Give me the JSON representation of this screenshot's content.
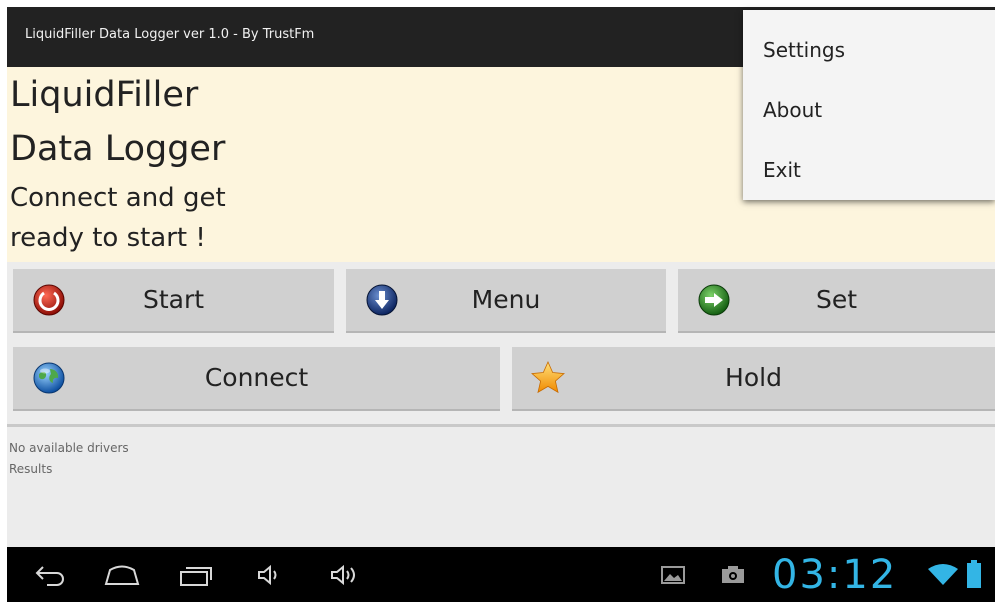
{
  "app": {
    "title": "LiquidFiller Data Logger ver 1.0 - By TrustFm"
  },
  "header": {
    "line1": "LiquidFiller",
    "line2": "Data Logger",
    "line3": "Connect and get",
    "line4": "ready to start !"
  },
  "buttons": {
    "start": "Start",
    "menu": "Menu",
    "set": "Set",
    "connect": "Connect",
    "hold": "Hold"
  },
  "log": {
    "line1": "No available drivers",
    "line2": "Results"
  },
  "overflow_menu": {
    "items": [
      "Settings",
      "About",
      "Exit"
    ]
  },
  "status": {
    "time": "03:12"
  },
  "icons": {
    "start": "power-icon",
    "menu": "arrow-down-icon",
    "set": "arrow-right-icon",
    "connect": "globe-icon",
    "hold": "star-icon"
  },
  "colors": {
    "header_bg": "#fdf5dd",
    "accent": "#33b5e5",
    "button_bg": "#d0d0d0"
  }
}
